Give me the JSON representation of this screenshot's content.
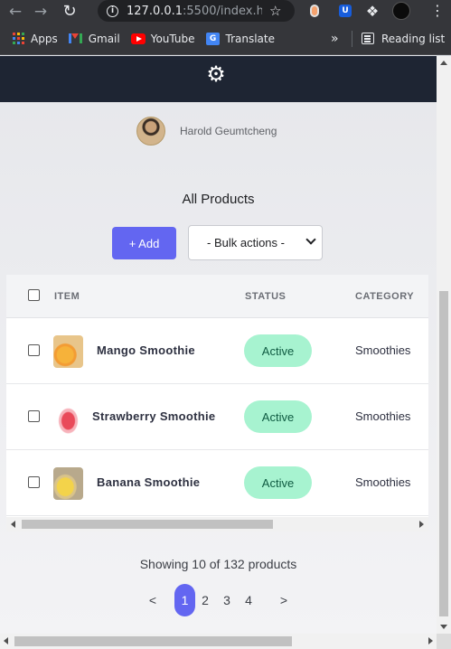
{
  "browser": {
    "url_main": "127.0.0.1",
    "url_rest": ":5500/index.h...",
    "bookmarks": [
      {
        "label": "Apps",
        "icon": "apps-grid-icon"
      },
      {
        "label": "Gmail",
        "icon": "gmail-icon"
      },
      {
        "label": "YouTube",
        "icon": "youtube-icon"
      },
      {
        "label": "Translate",
        "icon": "translate-icon"
      }
    ],
    "more_label": "»",
    "reading_list": "Reading list"
  },
  "user": {
    "name": "Harold Geumtcheng"
  },
  "page": {
    "title": "All Products",
    "add_label": "+ Add",
    "bulk_label": "- Bulk actions -"
  },
  "table": {
    "headers": {
      "item": "ITEM",
      "status": "STATUS",
      "category": "CATEGORY"
    },
    "rows": [
      {
        "name": "Mango Smoothie",
        "status": "Active",
        "category": "Smoothies"
      },
      {
        "name": "Strawberry Smoothie",
        "status": "Active",
        "category": "Smoothies"
      },
      {
        "name": "Banana Smoothie",
        "status": "Active",
        "category": "Smoothies"
      }
    ]
  },
  "footer": {
    "showing": "Showing 10 of 132 products",
    "prev": "<",
    "next": ">",
    "pages": [
      "1",
      "2",
      "3",
      "4"
    ],
    "current_page": "1"
  },
  "colors": {
    "header_bg": "#1e2533",
    "accent": "#6366f1",
    "status_bg": "#a7f3d0",
    "status_text": "#0f5b42"
  }
}
